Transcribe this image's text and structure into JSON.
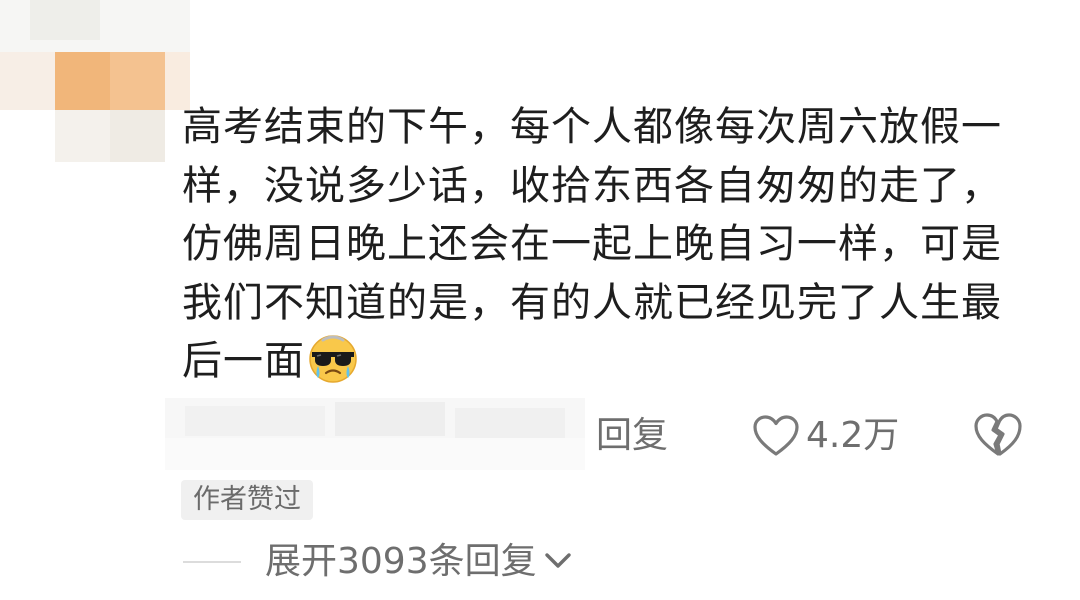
{
  "comment": {
    "text": "高考结束的下午，每个人都像每次周六放假一样，没说多少话，收拾东西各自匆匆的走了，仿佛周日晚上还会在一起上晚自习一样，可是我们不知道的是，有的人就已经见完了人生最后一面",
    "emoji": "crying-cool-sunglasses-emoji"
  },
  "actions": {
    "reply_label": "回复",
    "like_count": "4.2万",
    "like_icon": "heart-outline-icon",
    "dislike_icon": "broken-heart-icon"
  },
  "badge": {
    "author_liked": "作者赞过"
  },
  "replies": {
    "expand_label": "展开3093条回复",
    "expand_icon": "chevron-down-icon"
  },
  "colors": {
    "text": "#1e1e1e",
    "secondary": "#6e6e6e",
    "badge_bg": "#f0f0f0",
    "avatar_blur": "#f1b67a"
  }
}
